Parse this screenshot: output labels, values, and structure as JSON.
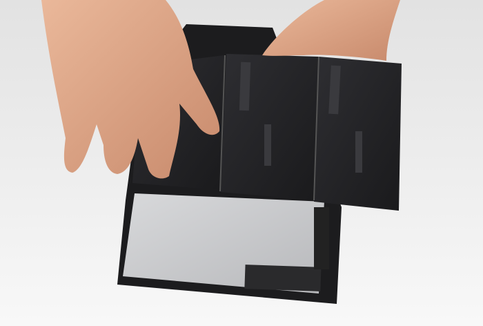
{
  "scene": {
    "colors": {
      "background_top": "#e4e4e4",
      "background_bottom": "#f7f7f7",
      "frame": "#1c1c1e",
      "housing": "#c9cacc",
      "battery": "#232326",
      "skin": "#e0a888"
    }
  }
}
